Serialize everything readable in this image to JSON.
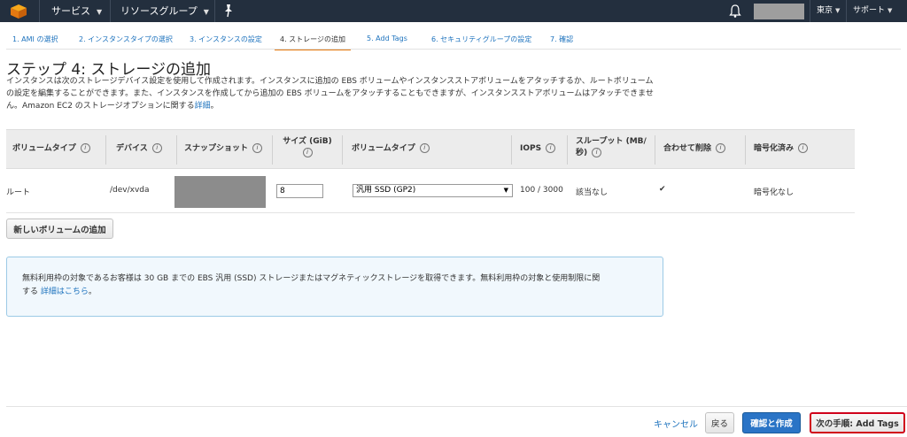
{
  "nav": {
    "services": "サービス",
    "resource_groups": "リソースグループ",
    "region": "東京",
    "support": "サポート"
  },
  "steps": [
    "1. AMI の選択",
    "2. インスタンスタイプの選択",
    "3. インスタンスの設定",
    "4. ストレージの追加",
    "5. Add Tags",
    "6. セキュリティグループの設定",
    "7. 確認"
  ],
  "active_step_index": 3,
  "page": {
    "title": "ステップ 4: ストレージの追加",
    "desc_line1": "インスタンスは次のストレージデバイス設定を使用して作成されます。インスタンスに追加の EBS ボリュームやインスタンスストアボリュームをアタッチするか、ルートボリューム",
    "desc_line2": "の設定を編集することができます。また、インスタンスを作成してから追加の EBS ボリュームをアタッチすることもできますが、インスタンスストアボリュームはアタッチできませ",
    "desc_line3": "ん。Amazon EC2 のストレージオプションに関する",
    "desc_link": "詳細",
    "desc_end": "。"
  },
  "table": {
    "headers": {
      "volume_type": "ボリュームタイプ",
      "device": "デバイス",
      "snapshot": "スナップショット",
      "size_line1": "サイズ (GiB)",
      "ebs_type": "ボリュームタイプ",
      "iops": "IOPS",
      "throughput_line1": "スループット (MB/",
      "throughput_line2": "秒)",
      "delete_on_term": "合わせて削除",
      "encrypted": "暗号化済み"
    },
    "row": {
      "volume_type": "ルート",
      "device": "/dev/xvda",
      "size": "8",
      "ebs_type": "汎用 SSD (GP2)",
      "iops": "100 / 3000",
      "throughput": "該当なし",
      "delete_on_term": true,
      "encrypted": "暗号化なし"
    }
  },
  "add_volume_button": "新しいボリュームの追加",
  "info": {
    "line1": "無料利用枠の対象であるお客様は 30 GB までの EBS 汎用 (SSD) ストレージまたはマグネティックストレージを取得できます。無料利用枠の対象と使用制限に関",
    "line2_prefix": "する ",
    "line2_link": "詳細はこちら",
    "line2_suffix": "。"
  },
  "footer": {
    "cancel": "キャンセル",
    "back": "戻る",
    "review_launch": "確認と作成",
    "next": "次の手順: Add Tags"
  }
}
